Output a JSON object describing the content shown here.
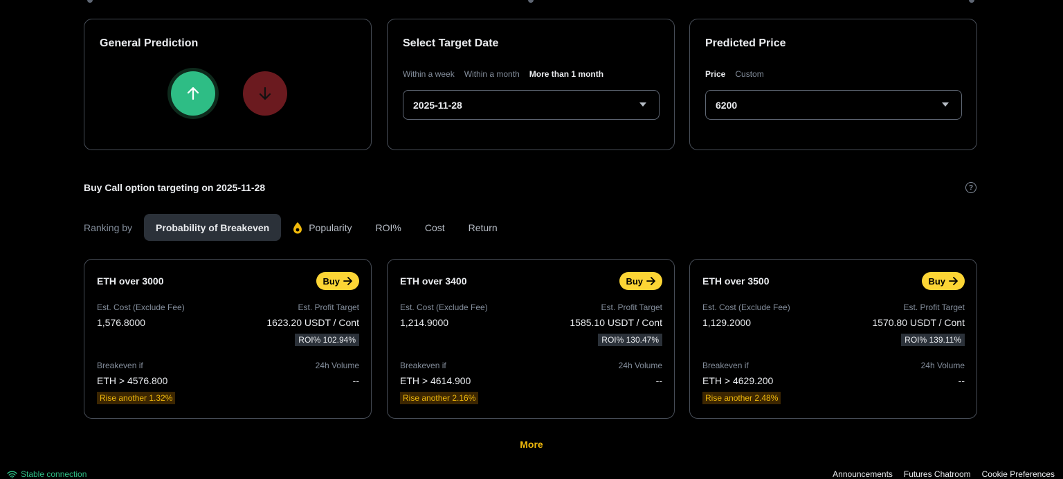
{
  "prediction": {
    "title": "General Prediction",
    "up_color": "#2ebd85",
    "down_color": "#6b1a1f"
  },
  "target_date": {
    "title": "Select Target Date",
    "tabs": [
      {
        "label": "Within a week",
        "active": false
      },
      {
        "label": "Within a month",
        "active": false
      },
      {
        "label": "More than 1 month",
        "active": true
      }
    ],
    "selected": "2025-11-28"
  },
  "predicted_price": {
    "title": "Predicted Price",
    "tabs": [
      {
        "label": "Price",
        "active": true
      },
      {
        "label": "Custom",
        "active": false
      }
    ],
    "selected": "6200"
  },
  "section": {
    "title": "Buy Call option targeting on 2025-11-28",
    "help_icon": "?"
  },
  "ranking": {
    "label": "Ranking by",
    "tabs": [
      {
        "label": "Probability of Breakeven",
        "active": true
      },
      {
        "label": "Popularity",
        "active": false,
        "icon": "fire-icon"
      },
      {
        "label": "ROI%",
        "active": false
      },
      {
        "label": "Cost",
        "active": false
      },
      {
        "label": "Return",
        "active": false
      }
    ]
  },
  "labels": {
    "buy": "Buy",
    "est_cost": "Est. Cost (Exclude Fee)",
    "est_profit": "Est. Profit Target",
    "breakeven": "Breakeven if",
    "volume": "24h Volume"
  },
  "cards": [
    {
      "title": "ETH over 3000",
      "cost": "1,576.8000",
      "profit": "1623.20 USDT / Cont",
      "roi": "ROI% 102.94%",
      "breakeven": "ETH > 4576.800",
      "volume": "--",
      "rise": "Rise another 1.32%"
    },
    {
      "title": "ETH over 3400",
      "cost": "1,214.9000",
      "profit": "1585.10 USDT / Cont",
      "roi": "ROI% 130.47%",
      "breakeven": "ETH > 4614.900",
      "volume": "--",
      "rise": "Rise another 2.16%"
    },
    {
      "title": "ETH over 3500",
      "cost": "1,129.2000",
      "profit": "1570.80 USDT / Cont",
      "roi": "ROI% 139.11%",
      "breakeven": "ETH > 4629.200",
      "volume": "--",
      "rise": "Rise another 2.48%"
    }
  ],
  "more": "More",
  "footer": {
    "status": "Stable connection",
    "links": [
      "Announcements",
      "Futures Chatroom",
      "Cookie Preferences"
    ]
  },
  "colors": {
    "accent": "#f0b90b",
    "buy_button": "#fcd535",
    "positive": "#2ebd85"
  }
}
